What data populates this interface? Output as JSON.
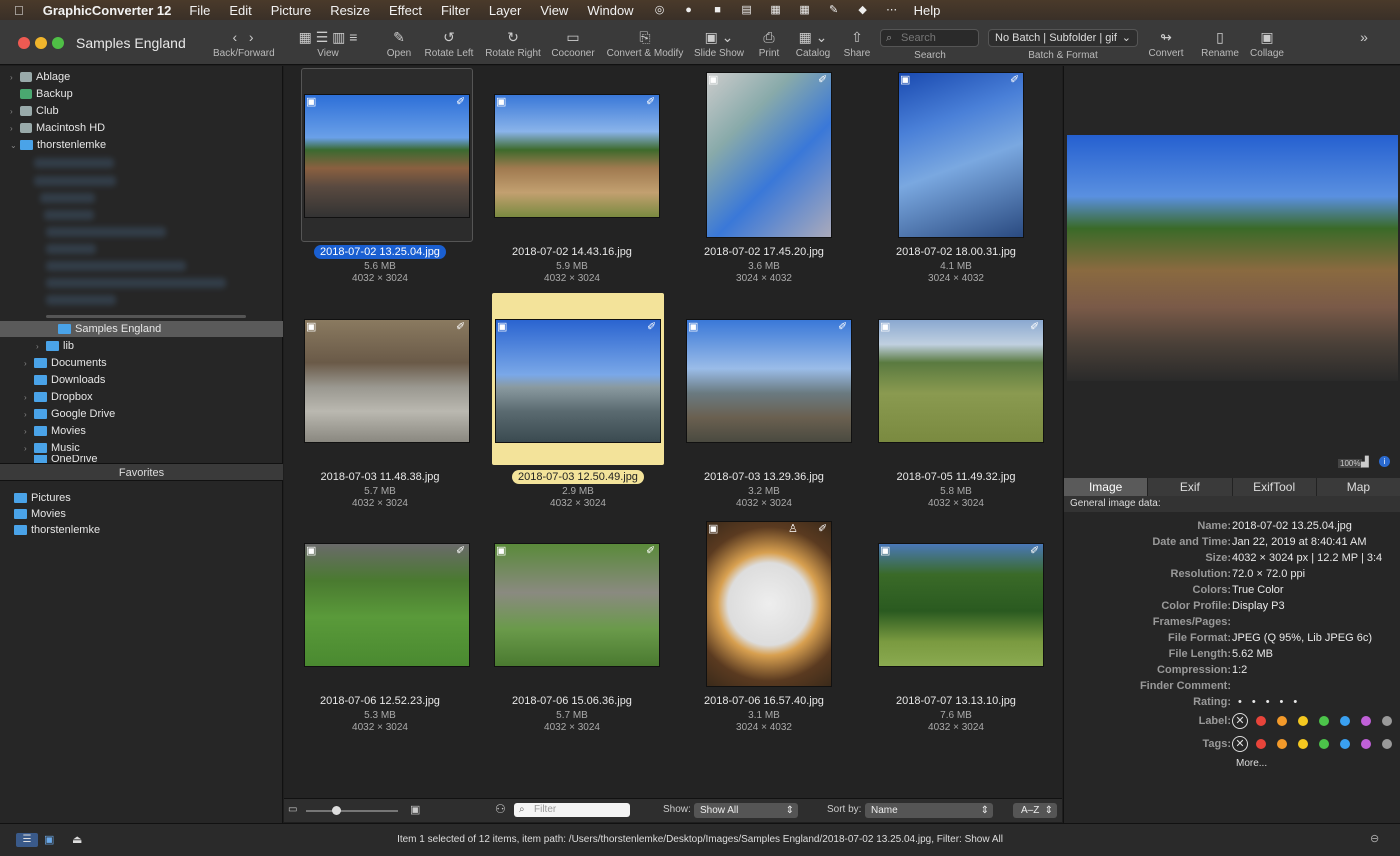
{
  "menubar": {
    "app": "GraphicConverter 12",
    "items": [
      "File",
      "Edit",
      "Picture",
      "Resize",
      "Effect",
      "Filter",
      "Layer",
      "View",
      "Window"
    ],
    "help": "Help"
  },
  "window": {
    "title": "Samples England"
  },
  "toolbar": {
    "back_forward": "Back/Forward",
    "view": "View",
    "open": "Open",
    "rotate_left": "Rotate Left",
    "rotate_right": "Rotate Right",
    "cocooner": "Cocooner",
    "convert_modify": "Convert & Modify",
    "slide_show": "Slide Show",
    "print": "Print",
    "catalog": "Catalog",
    "share": "Share",
    "search_placeholder": "Search",
    "search": "Search",
    "batch_value": "No Batch | Subfolder | gif",
    "batch_label": "Batch & Format",
    "convert": "Convert",
    "rename": "Rename",
    "collage": "Collage"
  },
  "sidebar": {
    "volumes": [
      "Ablage",
      "Backup",
      "Club",
      "Macintosh HD",
      "thorstenlemke"
    ],
    "selected": "Samples England",
    "folders": [
      "lib",
      "Documents",
      "Downloads",
      "Dropbox",
      "Google Drive",
      "Movies",
      "Music",
      "OneDrive"
    ],
    "favorites_title": "Favorites",
    "favorites": [
      "Pictures",
      "Movies",
      "thorstenlemke"
    ]
  },
  "files": [
    {
      "name": "2018-07-02 13.25.04.jpg",
      "size": "5.6 MB",
      "dims": "4032 × 3024"
    },
    {
      "name": "2018-07-02 14.43.16.jpg",
      "size": "5.9 MB",
      "dims": "4032 × 3024"
    },
    {
      "name": "2018-07-02 17.45.20.jpg",
      "size": "3.6 MB",
      "dims": "3024 × 4032"
    },
    {
      "name": "2018-07-02 18.00.31.jpg",
      "size": "4.1 MB",
      "dims": "3024 × 4032"
    },
    {
      "name": "2018-07-03 11.48.38.jpg",
      "size": "5.7 MB",
      "dims": "4032 × 3024"
    },
    {
      "name": "2018-07-03 12.50.49.jpg",
      "size": "2.9 MB",
      "dims": "4032 × 3024"
    },
    {
      "name": "2018-07-03 13.29.36.jpg",
      "size": "3.2 MB",
      "dims": "4032 × 3024"
    },
    {
      "name": "2018-07-05 11.49.32.jpg",
      "size": "5.8 MB",
      "dims": "4032 × 3024"
    },
    {
      "name": "2018-07-06 12.52.23.jpg",
      "size": "5.3 MB",
      "dims": "4032 × 3024"
    },
    {
      "name": "2018-07-06 15.06.36.jpg",
      "size": "5.7 MB",
      "dims": "4032 × 3024"
    },
    {
      "name": "2018-07-06 16.57.40.jpg",
      "size": "3.1 MB",
      "dims": "3024 × 4032"
    },
    {
      "name": "2018-07-07 13.13.10.jpg",
      "size": "7.6 MB",
      "dims": "4032 × 3024"
    }
  ],
  "bottombar": {
    "filter_placeholder": "Filter",
    "show_label": "Show:",
    "show_value": "Show All",
    "sort_label": "Sort by:",
    "sort_value": "Name",
    "order": "A–Z"
  },
  "preview": {
    "zoom": "100%"
  },
  "tabs": [
    "Image",
    "Exif",
    "ExifTool",
    "Map"
  ],
  "info": {
    "header": "General image data:",
    "rows": [
      {
        "k": "Name:",
        "v": "2018-07-02 13.25.04.jpg"
      },
      {
        "k": "Date and Time:",
        "v": "Jan 22, 2019 at 8:40:41 AM"
      },
      {
        "k": "Size:",
        "v": "4032 × 3024 px | 12.2 MP | 3:4"
      },
      {
        "k": "Resolution:",
        "v": "72.0 × 72.0 ppi"
      },
      {
        "k": "Colors:",
        "v": "True Color"
      },
      {
        "k": "Color Profile:",
        "v": "Display P3"
      },
      {
        "k": "Frames/Pages:",
        "v": ""
      },
      {
        "k": "File Format:",
        "v": "JPEG (Q 95%, Lib JPEG 6c)"
      },
      {
        "k": "File Length:",
        "v": "5.62 MB"
      },
      {
        "k": "Compression:",
        "v": "1:2"
      },
      {
        "k": "Finder Comment:",
        "v": ""
      }
    ],
    "rating_label": "Rating:",
    "label_label": "Label:",
    "tags_label": "Tags:",
    "more": "More..."
  },
  "colors": {
    "label_dots": [
      "#e8443a",
      "#f39a2a",
      "#f5c820",
      "#4cc44a",
      "#3aa0f0",
      "#c060d8",
      "#9a9a9a"
    ]
  },
  "status": "Item 1 selected of 12 items, item path: /Users/thorstenlemke/Desktop/Images/Samples England/2018-07-02 13.25.04.jpg, Filter: Show All"
}
